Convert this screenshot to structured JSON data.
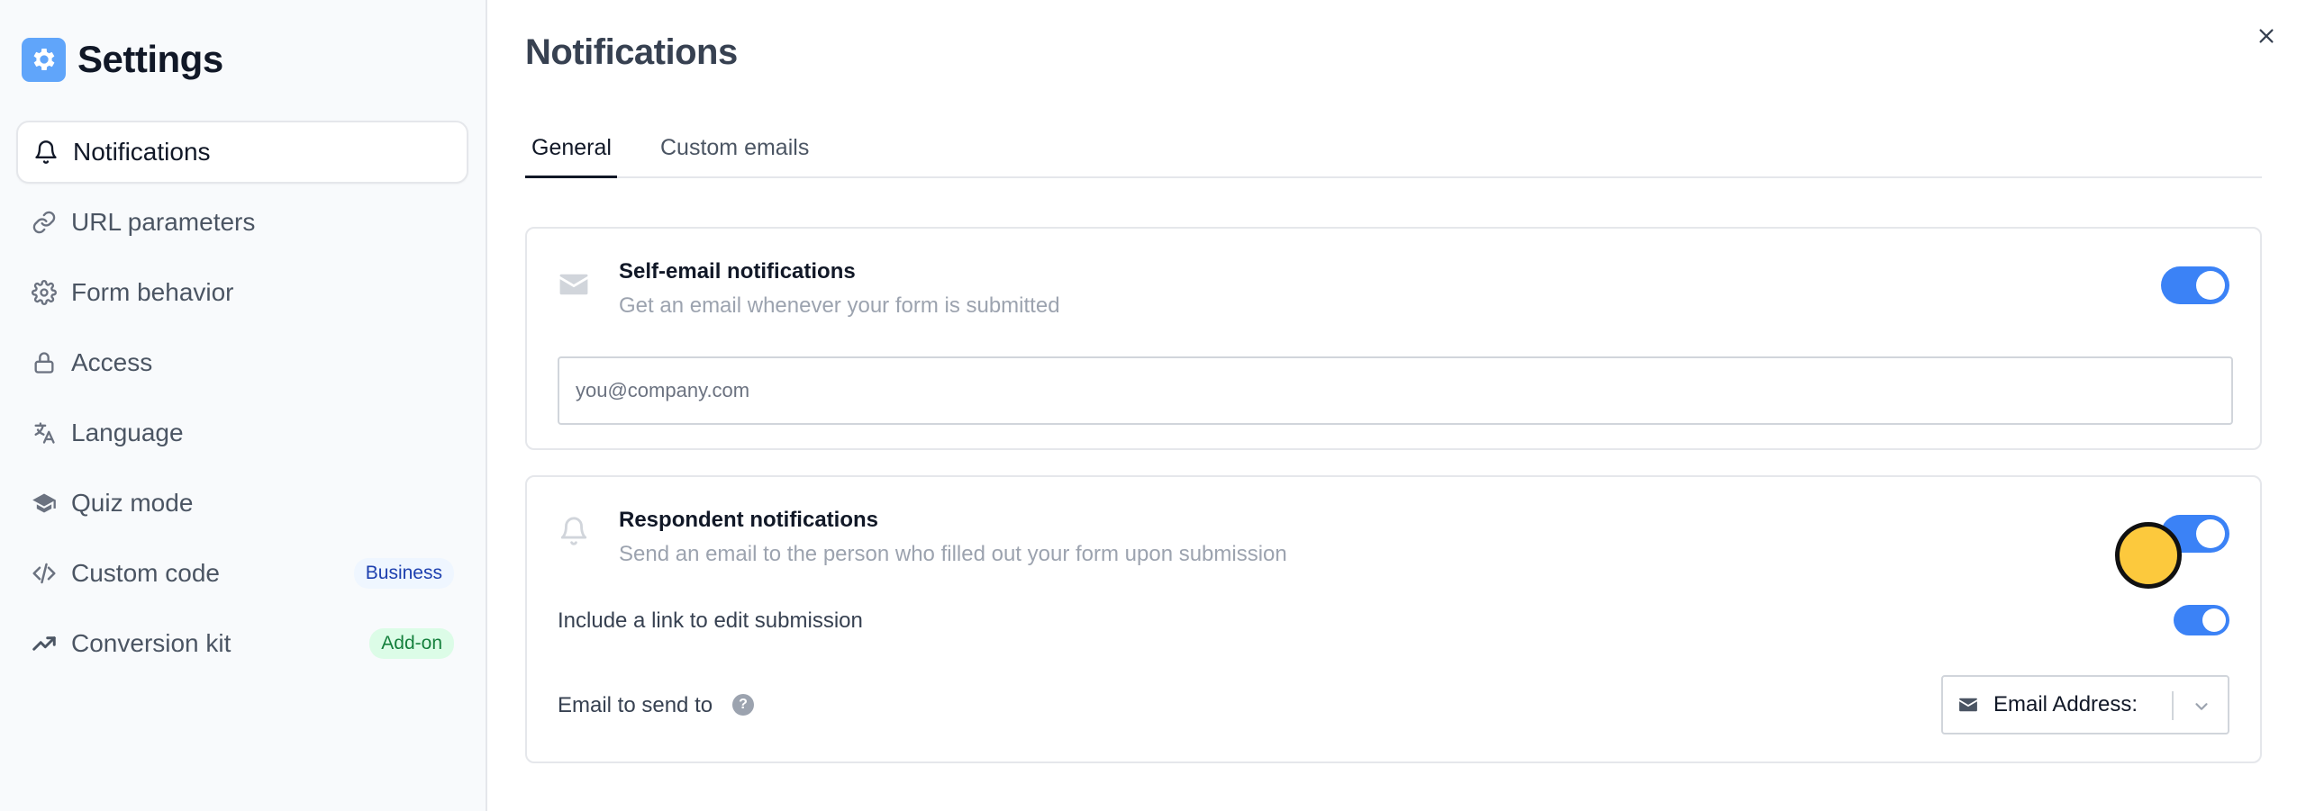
{
  "sidebar": {
    "title": "Settings",
    "items": [
      {
        "label": "Notifications",
        "icon": "bell-icon",
        "active": true
      },
      {
        "label": "URL parameters",
        "icon": "link-icon"
      },
      {
        "label": "Form behavior",
        "icon": "gear-icon"
      },
      {
        "label": "Access",
        "icon": "lock-icon"
      },
      {
        "label": "Language",
        "icon": "translate-icon"
      },
      {
        "label": "Quiz mode",
        "icon": "graduation-cap-icon"
      },
      {
        "label": "Custom code",
        "icon": "code-icon",
        "badge": "Business"
      },
      {
        "label": "Conversion kit",
        "icon": "trending-up-icon",
        "badge": "Add-on"
      }
    ]
  },
  "main": {
    "title": "Notifications",
    "tabs": [
      {
        "label": "General",
        "active": true
      },
      {
        "label": "Custom emails",
        "active": false
      }
    ],
    "self_email": {
      "title": "Self-email notifications",
      "description": "Get an email whenever your form is submitted",
      "enabled": true,
      "input_placeholder": "you@company.com",
      "input_value": ""
    },
    "respondent": {
      "title": "Respondent notifications",
      "description": "Send an email to the person who filled out your form upon submission",
      "enabled": true,
      "include_link_label": "Include a link to edit submission",
      "include_link_enabled": true,
      "email_to_label": "Email to send to",
      "select_value": "Email Address:"
    }
  },
  "colors": {
    "accent": "#3b82f6",
    "brand_logo": "#60a5fa",
    "business_badge_text": "#1e40af",
    "addon_badge_text": "#15803d",
    "cursor": "#fcc93d"
  }
}
